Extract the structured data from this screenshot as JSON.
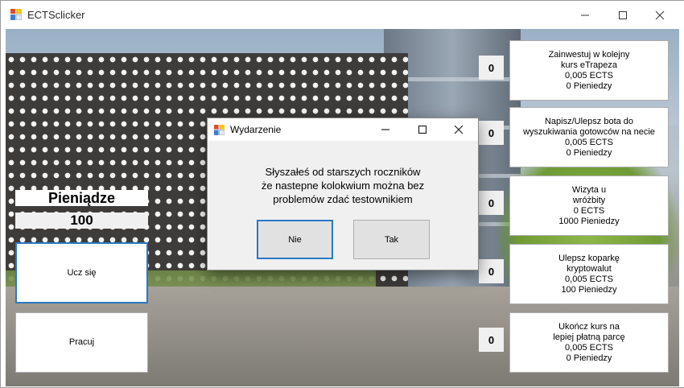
{
  "window": {
    "title": "ECTSclicker"
  },
  "stats": {
    "money_label": "Pieniądze",
    "money_value": "100"
  },
  "actions": {
    "study": "Ucz się",
    "work": "Pracuj"
  },
  "upgrades": [
    {
      "count": "0",
      "lines": [
        "Zainwestuj w kolejny",
        "kurs eTrapeza",
        "0,005 ECTS",
        "0 Pieniedzy"
      ]
    },
    {
      "count": "0",
      "lines": [
        "Napisz/Ulepsz bota do",
        "wyszukiwania gotowców na necie",
        "0,005 ECTS",
        "0 Pieniedzy"
      ]
    },
    {
      "count": "0",
      "lines": [
        "Wizyta u",
        "wróżbity",
        "0 ECTS",
        "1000 Pieniedzy"
      ]
    },
    {
      "count": "0",
      "lines": [
        "Ulepsz koparkę",
        "kryptowalut",
        "0,005 ECTS",
        "100 Pieniedzy"
      ]
    },
    {
      "count": "0",
      "lines": [
        "Ukończ kurs na",
        "lepiej płatną parcę",
        "0,005 ECTS",
        "0 Pieniedzy"
      ]
    }
  ],
  "dialog": {
    "title": "Wydarzenie",
    "message": [
      "Słyszałeś od starszych roczników",
      "że nastepne kolokwium można bez",
      "problemów zdać testownikiem"
    ],
    "no": "Nie",
    "yes": "Tak"
  },
  "icons": {
    "app": "app-icon",
    "minimize": "minimize-icon",
    "maximize": "maximize-icon",
    "close": "close-icon"
  },
  "colors": {
    "focus": "#2b78c6",
    "button_face": "#e1e1e1",
    "form_bg": "#f0f0f0"
  }
}
